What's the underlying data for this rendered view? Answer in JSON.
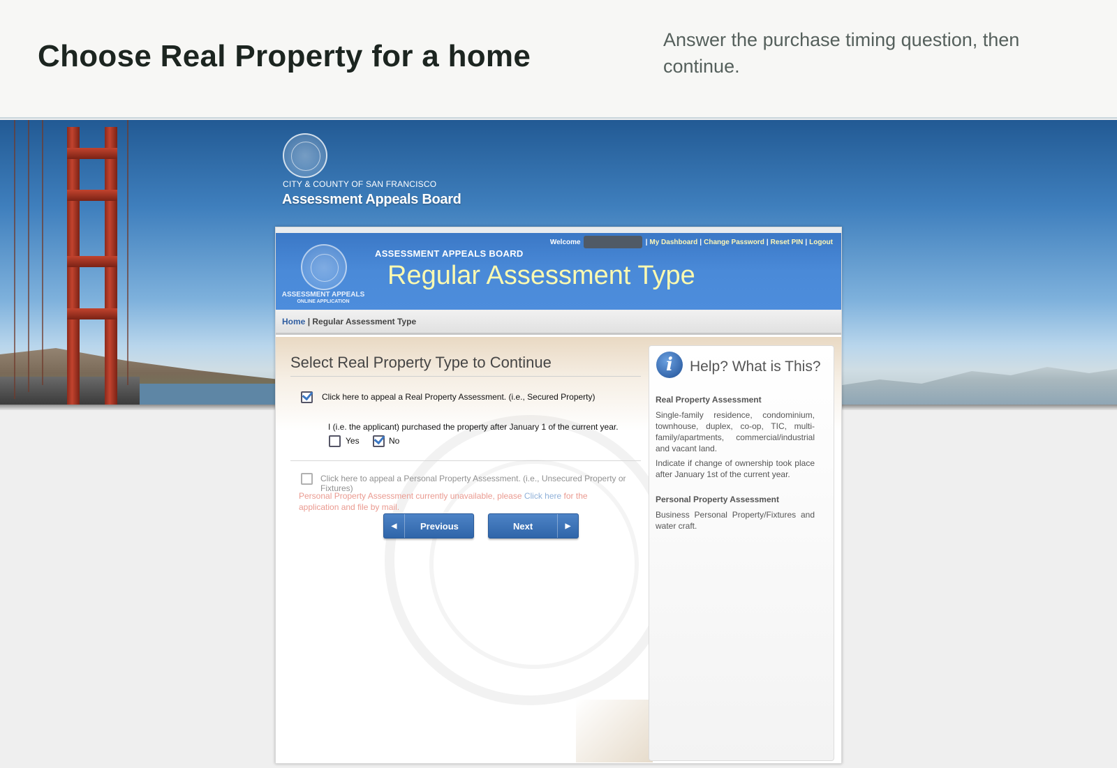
{
  "tutorial": {
    "title": "Choose Real Property for a home",
    "instruction": "Answer the purchase timing question, then continue."
  },
  "banner": {
    "org_small": "CITY & COUNTY OF SAN FRANCISCO",
    "org_big": "Assessment Appeals Board"
  },
  "app": {
    "seal_label_line1": "ASSESSMENT APPEALS",
    "seal_label_line2": "ONLINE APPLICATION",
    "board_label": "ASSESSMENT APPEALS BOARD",
    "page_title": "Regular Assessment Type",
    "user_nav": {
      "welcome": "Welcome",
      "links": [
        "My Dashboard",
        "Change Password",
        "Reset PIN",
        "Logout"
      ],
      "separator": "|"
    },
    "breadcrumb": {
      "home": "Home",
      "separator": "|",
      "current": "Regular Assessment Type"
    }
  },
  "form": {
    "section_title": "Select Real Property Type to Continue",
    "real_property_option": "Click here to appeal a Real Property Assessment. (i.e., Secured Property)",
    "real_property_checked": true,
    "purchase_question": "I (i.e. the applicant) purchased the property after January 1 of the current year.",
    "yes_label": "Yes",
    "yes_checked": false,
    "no_label": "No",
    "no_checked": true,
    "personal_property_option": "Click here to appeal a Personal Property Assessment. (i.e., Unsecured Property or Fixtures)",
    "personal_property_checked": false,
    "warning_prefix": "Personal Property Assessment currently unavailable, please ",
    "warning_link": "Click here",
    "warning_suffix": " for the application and file by mail.",
    "previous_label": "Previous",
    "next_label": "Next"
  },
  "help": {
    "title": "Help? What is This?",
    "real_heading": "Real Property Assessment",
    "real_text": "Single-family residence, condominium, townhouse, duplex, co-op, TIC, multi-family/apartments, commercial/industrial and vacant land.",
    "real_note": "Indicate if change of ownership took place after January 1st of the current year.",
    "personal_heading": "Personal Property Assessment",
    "personal_text": "Business Personal Property/Fixtures and water craft."
  },
  "colors": {
    "header_blue": "#4a8ad8",
    "title_yellow": "#fbf9b0",
    "button_blue": "#2f65a9",
    "warning_red": "#ea9a90"
  },
  "icons": {
    "checkbox": "checkbox-icon",
    "info": "info-icon",
    "arrow_left": "arrow-left-icon",
    "arrow_right": "arrow-right-icon",
    "seal": "city-seal-icon"
  }
}
